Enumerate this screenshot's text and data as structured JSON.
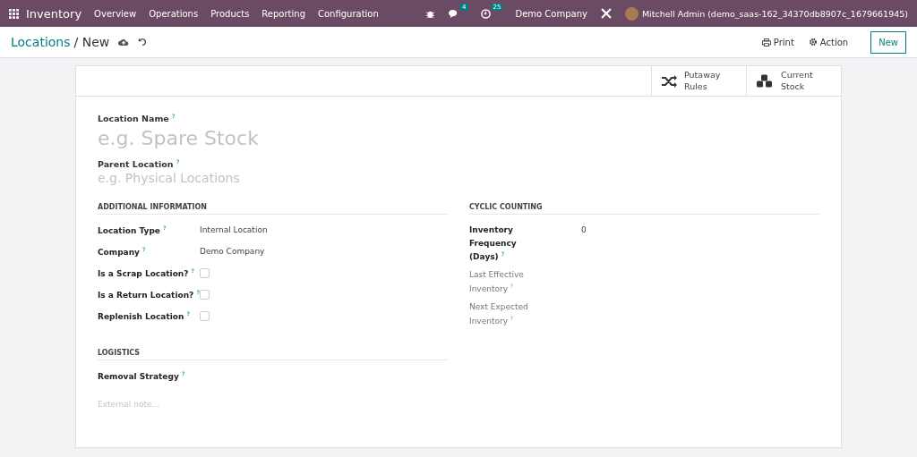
{
  "navbar": {
    "app": "Inventory",
    "menu": [
      "Overview",
      "Operations",
      "Products",
      "Reporting",
      "Configuration"
    ],
    "messages_count": "4",
    "activities_count": "25",
    "company": "Demo Company",
    "user": "Mitchell Admin (demo_saas-162_34370db8907c_1679661945)"
  },
  "control_panel": {
    "breadcrumb": "Locations",
    "separator": "/",
    "current": "New",
    "print": "Print",
    "action": "Action",
    "new": "New"
  },
  "smart_buttons": [
    {
      "kind": "shuffle",
      "label": "Putaway Rules"
    },
    {
      "kind": "cubes",
      "label": "Current Stock"
    }
  ],
  "title_field": {
    "label": "Location Name $^{?}$",
    "placeholder": "e.g. Spare Stock"
  },
  "parent_field": {
    "label": "Parent Location $^{?}$",
    "placeholder": "e.g. Physical Locations"
  },
  "additional_information": {
    "title": "ADDITIONAL INFORMATION",
    "fields": [
      {
        "kind": "text",
        "label": "Location Type $^{?}$",
        "value": "Internal Location"
      },
      {
        "kind": "text",
        "label": "Company $^{?}$",
        "value": "Demo Company"
      },
      {
        "kind": "checkbox",
        "label": "Is a Scrap Location? $^{?}$",
        "checked": false
      },
      {
        "kind": "checkbox",
        "label": "Is a Return Location? $^{?}$",
        "checked": false
      },
      {
        "kind": "checkbox",
        "label": "Replenish Location $^{?}$",
        "checked": false
      }
    ]
  },
  "cyclic_counting": {
    "title": "CYCLIC COUNTING",
    "fields": [
      {
        "label": "Inventory Frequency (Days) $^{?}$",
        "value": "0",
        "readonly": false
      },
      {
        "label": "Last Effective Inventory $^{?}$",
        "readonly": true
      },
      {
        "label": "Next Expected Inventory $^{?}$",
        "readonly": true
      }
    ]
  },
  "logistics": {
    "title": "LOGISTICS",
    "fields": [
      {
        "label": "Removal Strategy $^{?}$"
      }
    ]
  },
  "note": {
    "placeholder": "External note..."
  }
}
